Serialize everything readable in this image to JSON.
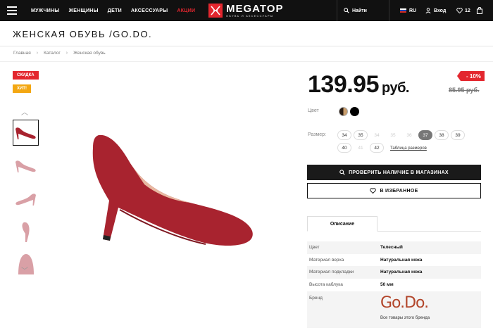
{
  "header": {
    "nav": [
      "МУЖЧИНЫ",
      "ЖЕНЩИНЫ",
      "ДЕТИ",
      "АКСЕССУАРЫ",
      "АКЦИИ"
    ],
    "logo_name": "MEGATOP",
    "logo_sub": "ОБУВЬ И АКСЕССУАРЫ",
    "search_label": "Найти",
    "lang": "RU",
    "login_label": "Вход",
    "favorites_count": "12"
  },
  "page": {
    "title": "ЖЕНСКАЯ ОБУВЬ /GO.DO.",
    "breadcrumbs": [
      "Главная",
      "Каталог",
      "Женская обувь"
    ]
  },
  "badges": {
    "sale": "СКИДКА",
    "hit": "ХИТ!"
  },
  "product": {
    "price": "139.95",
    "currency": "руб.",
    "discount": "- 10%",
    "old_price": "85.95 руб.",
    "color_label": "Цвет",
    "size_label": "Размер:",
    "sizes": [
      {
        "v": "34",
        "state": "available"
      },
      {
        "v": "35",
        "state": "available"
      },
      {
        "v": "34",
        "state": "unavailable"
      },
      {
        "v": "35",
        "state": "unavailable"
      },
      {
        "v": "36",
        "state": "unavailable"
      },
      {
        "v": "37",
        "state": "selected"
      },
      {
        "v": "38",
        "state": "available"
      },
      {
        "v": "39",
        "state": "available"
      },
      {
        "v": "40",
        "state": "available"
      },
      {
        "v": "41",
        "state": "unavailable"
      },
      {
        "v": "42",
        "state": "available"
      }
    ],
    "size_table_link": "Таблица размеров",
    "check_button": "ПРОВЕРИТЬ НАЛИЧИЕ В МАГАЗИНАХ",
    "favorite_button": "В ИЗБРАННОЕ",
    "tab_description": "Описание",
    "specs": [
      {
        "k": "Цвет",
        "v": "Телесный"
      },
      {
        "k": "Материал верха",
        "v": "Натуральная кожа"
      },
      {
        "k": "Материал подкладки",
        "v": "Натуральная кожа"
      },
      {
        "k": "Высота каблука",
        "v": "50 мм"
      }
    ],
    "brand_label": "Бренд",
    "brand_logo": "Go.Do.",
    "brand_link": "Все товары этого бренда"
  },
  "colors": {
    "accent": "#e3262e",
    "hit": "#f3a712",
    "shoe_main": "#a8232f",
    "shoe_thumb": "#d9a0a6",
    "brand": "#b2452a"
  }
}
